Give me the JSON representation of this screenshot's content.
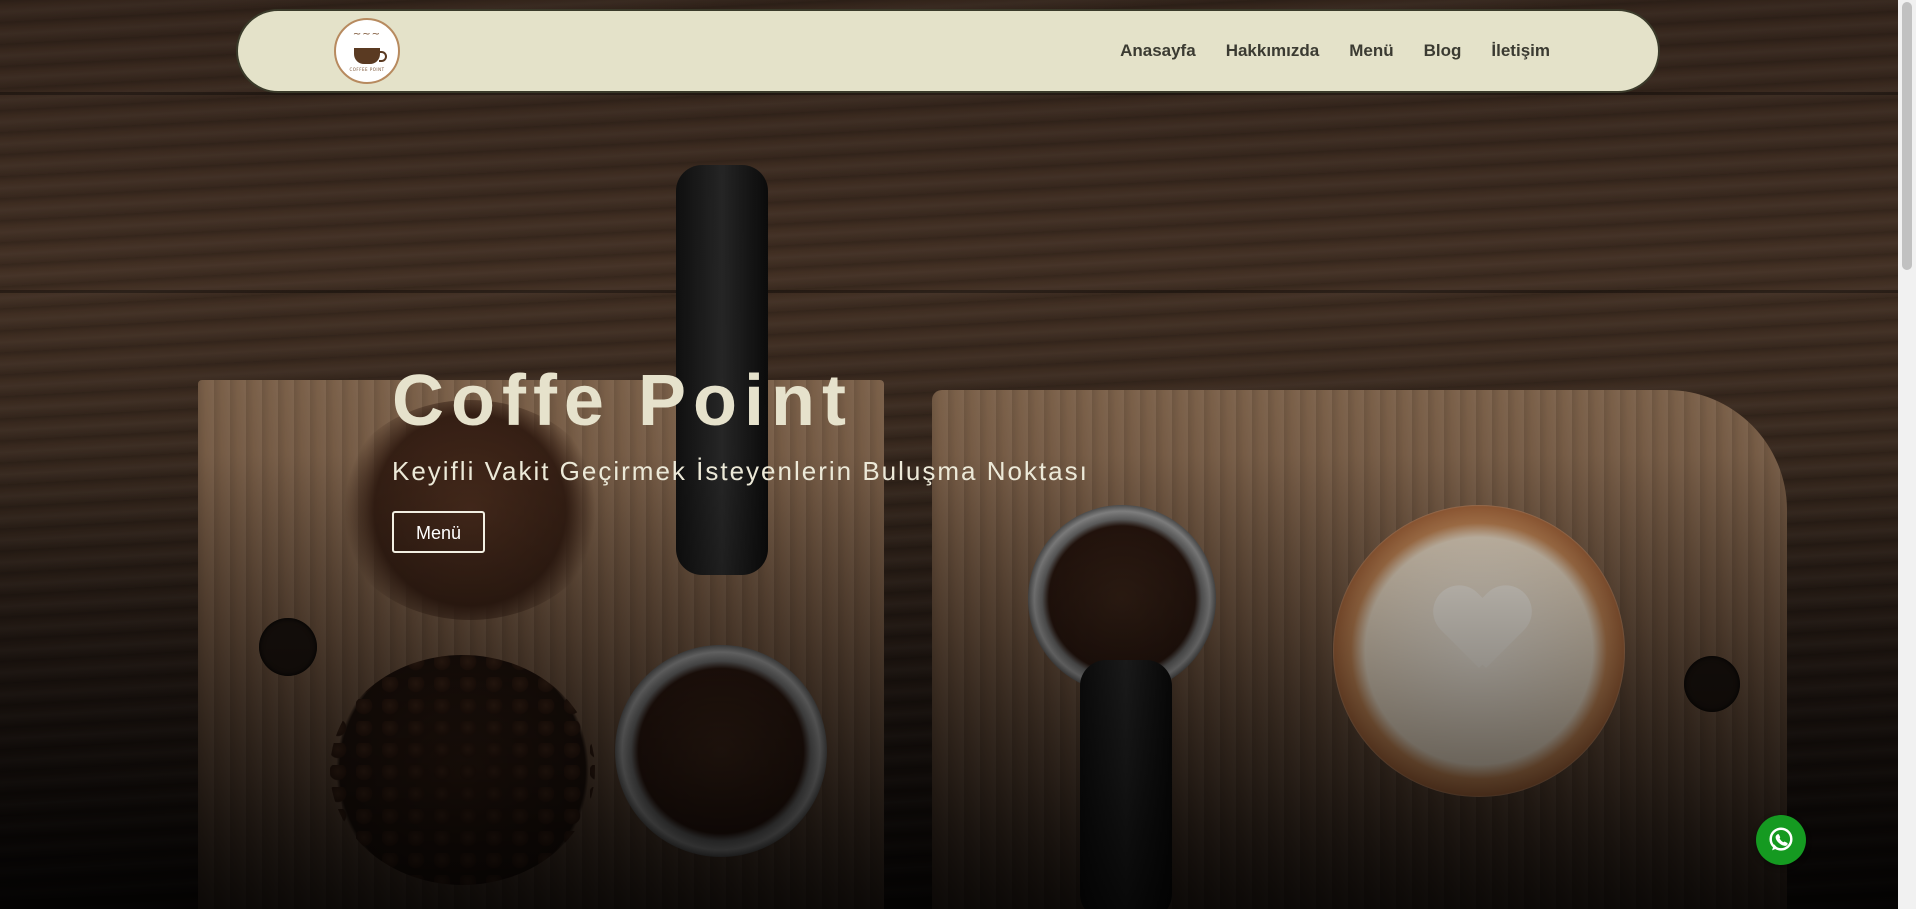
{
  "logo": {
    "text": "COFFEE POINT",
    "alt": "Coffe Point logosu"
  },
  "nav": {
    "links": [
      "Anasayfa",
      "Hakkımızda",
      "Menü",
      "Blog",
      "İletişim"
    ]
  },
  "hero": {
    "title": "Coffe Point",
    "subtitle": "Keyifli Vakit Geçirmek İsteyenlerin Buluşma Noktası",
    "button_label": "Menü"
  },
  "whatsapp": {
    "icon": "whatsapp-icon"
  },
  "colors": {
    "navbar_bg": "#e4e2c9",
    "hero_title": "#e6e2cc",
    "whatsapp_green": "#159a21"
  }
}
